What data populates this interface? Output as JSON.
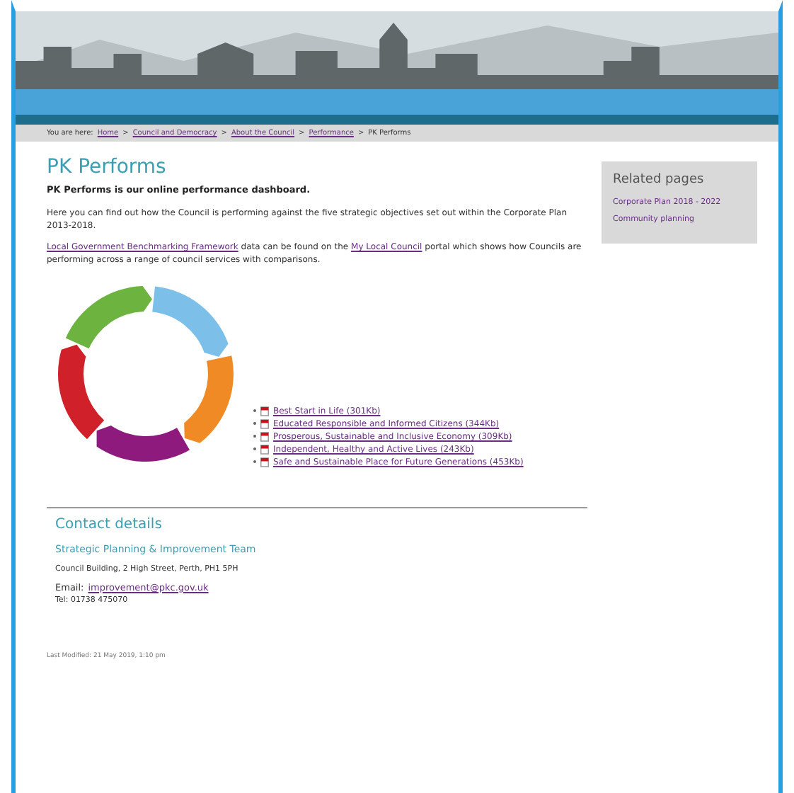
{
  "breadcrumb": {
    "label": "You are here:",
    "separator": ">",
    "links": [
      "Home",
      "Council and Democracy",
      "About the Council",
      "Performance"
    ],
    "current": "PK Performs"
  },
  "main": {
    "title": "PK Performs",
    "intro": "PK Performs is our online performance dashboard.",
    "description": "Here you can find out how the Council is performing against the five strategic objectives set out within the Corporate Plan 2013-2018.",
    "benchmark_text": [
      {
        "kind": "link",
        "text": "Local Government Benchmarking Framework"
      },
      {
        "kind": "text",
        "text": " data can be found on the "
      },
      {
        "kind": "link",
        "text": "My Local Council"
      },
      {
        "kind": "text",
        "text": " portal which shows how Councils are performing across a range of council services with comparisons."
      }
    ],
    "documents": [
      "Best Start in Life (301Kb)",
      "Educated Responsible and Informed Citizens (344Kb)",
      "Prosperous, Sustainable and Inclusive Economy (309Kb)",
      "Independent, Healthy and Active Lives (243Kb)",
      "Safe and Sustainable Place for Future Generations (453Kb)"
    ]
  },
  "contact": {
    "title": "Contact details",
    "team": "Strategic Planning & Improvement Team",
    "address": "Council Building, 2 High Street, Perth, PH1 5PH",
    "email_label": "Email:",
    "email": "improvement@pkc.gov.uk",
    "phone": "Tel: 01738 475070"
  },
  "last_modified": "Last Modified: 21 May 2019, 1:10 pm",
  "related": {
    "title": "Related pages",
    "links": [
      "Corporate Plan 2018 - 2022",
      "Community planning"
    ]
  }
}
